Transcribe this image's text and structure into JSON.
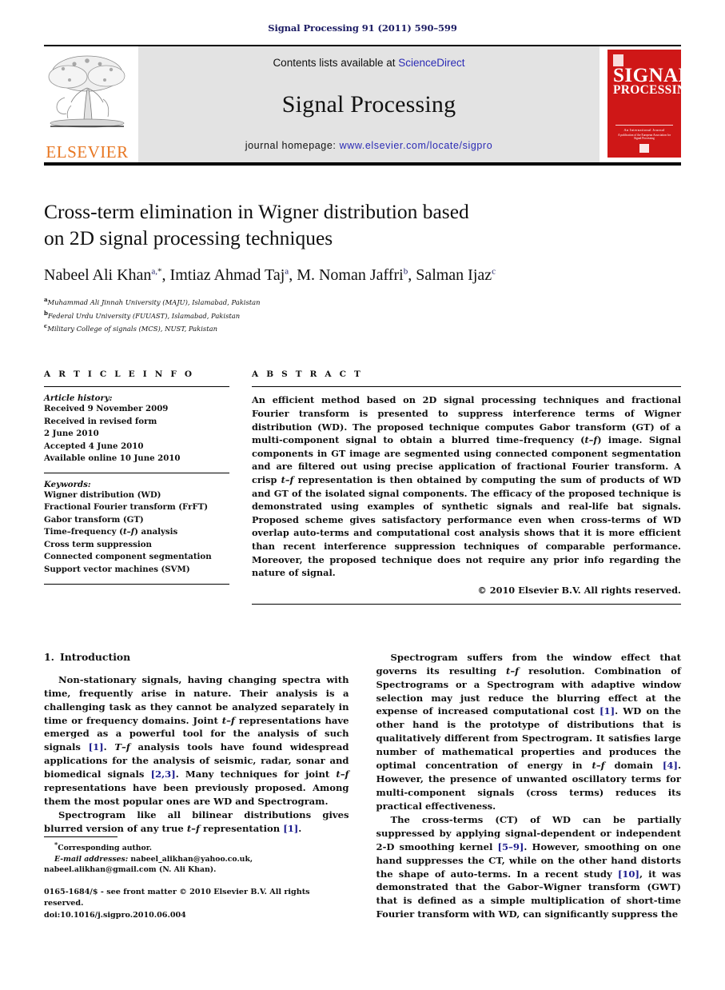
{
  "running_head": "Signal Processing 91 (2011) 590–599",
  "masthead": {
    "elsevier_wordmark": "ELSEVIER",
    "contents_prefix": "Contents lists available at ",
    "contents_link": "ScienceDirect",
    "journal_name": "Signal Processing",
    "homepage_prefix": "journal homepage: ",
    "homepage_link": "www.elsevier.com/locate/sigpro",
    "cover": {
      "title_line1": "SIGNAL",
      "title_line2": "PROCESSING",
      "footer_line1": "An International Journal",
      "footer_line2": "A publication of the European Association for Signal Processing"
    }
  },
  "article": {
    "title_line1": "Cross-term elimination in Wigner distribution based",
    "title_line2": "on 2D signal processing techniques",
    "authors": [
      {
        "name": "Nabeel Ali Khan",
        "sup": "a,",
        "star": "*",
        "sep": ", "
      },
      {
        "name": "Imtiaz Ahmad Taj",
        "sup": "a",
        "star": "",
        "sep": ", "
      },
      {
        "name": "M. Noman Jaffri",
        "sup": "b",
        "star": "",
        "sep": ", "
      },
      {
        "name": "Salman Ijaz",
        "sup": "c",
        "star": "",
        "sep": ""
      }
    ],
    "affiliations": [
      {
        "mark": "a",
        "text": "Muhammad Ali Jinnah University (MAJU), Islamabad, Pakistan"
      },
      {
        "mark": "b",
        "text": "Federal Urdu University (FUUAST), Islamabad, Pakistan"
      },
      {
        "mark": "c",
        "text": "Military College of signals (MCS), NUST, Pakistan"
      }
    ]
  },
  "article_info": {
    "heading": "A R T I C L E   I N F O",
    "history_label": "Article history:",
    "history": [
      "Received 9 November 2009",
      "Received in revised form",
      "2 June 2010",
      "Accepted 4 June 2010",
      "Available online 10 June 2010"
    ],
    "keywords_label": "Keywords:",
    "keywords": [
      "Wigner distribution (WD)",
      "Fractional Fourier transform (FrFT)",
      "Gabor transform (GT)",
      "Time–frequency (t–f) analysis",
      "Cross term suppression",
      "Connected component segmentation",
      "Support vector machines (SVM)"
    ]
  },
  "abstract": {
    "heading": "A B S T R A C T",
    "text": "An efficient method based on 2D signal processing techniques and fractional Fourier transform is presented to suppress interference terms of Wigner distribution (WD). The proposed technique computes Gabor transform (GT) of a multi-component signal to obtain a blurred time–frequency (t–f) image. Signal components in GT image are segmented using connected component segmentation and are filtered out using precise application of fractional Fourier transform. A crisp t–f representation is then obtained by computing the sum of products of WD and GT of the isolated signal components. The efficacy of the proposed technique is demonstrated using examples of synthetic signals and real-life bat signals. Proposed scheme gives satisfactory performance even when cross-terms of WD overlap auto-terms and computational cost analysis shows that it is more efficient than recent interference suppression techniques of comparable performance. Moreover, the proposed technique does not require any prior info regarding the nature of signal.",
    "copyright": "© 2010 Elsevier B.V. All rights reserved."
  },
  "section": {
    "number": "1.",
    "title": "Introduction"
  },
  "body": {
    "left_paragraphs": [
      "Non-stationary signals, having changing spectra with time, frequently arise in nature. Their analysis is a challenging task as they cannot be analyzed separately in time or frequency domains. Joint t–f representations have emerged as a powerful tool for the analysis of such signals [1]. T–f analysis tools have found widespread applications for the analysis of seismic, radar, sonar and biomedical signals [2,3]. Many techniques for joint t–f representations have been previously proposed. Among them the most popular ones are WD and Spectrogram.",
      "Spectrogram like all bilinear distributions gives blurred version of any true t–f representation [1]."
    ],
    "right_paragraphs": [
      "Spectrogram suffers from the window effect that governs its resulting t–f resolution. Combination of Spectrograms or a Spectrogram with adaptive window selection may just reduce the blurring effect at the expense of increased computational cost [1]. WD on the other hand is the prototype of distributions that is qualitatively different from Spectrogram. It satisfies large number of mathematical properties and produces the optimal concentration of energy in t–f domain [4]. However, the presence of unwanted oscillatory terms for multi-component signals (cross terms) reduces its practical effectiveness.",
      "The cross-terms (CT) of WD can be partially suppressed by applying signal-dependent or independent 2-D smoothing kernel [5–9]. However, smoothing on one hand suppresses the CT, while on the other hand distorts the shape of auto-terms. In a recent study [10], it was demonstrated that the Gabor–Wigner transform (GWT) that is defined as a simple multiplication of short-time Fourier transform with WD, can significantly suppress the"
    ]
  },
  "footnotes": {
    "corresponding": "Corresponding author.",
    "email_label": "E-mail addresses:",
    "email_1": "nabeel_alikhan@yahoo.co.uk,",
    "email_2": "nabeel.alikhan@gmail.com (N. Ali Khan).",
    "imprint_line1": "0165-1684/$ - see front matter © 2010 Elsevier B.V. All rights reserved.",
    "imprint_line2": "doi:10.1016/j.sigpro.2010.06.004"
  },
  "colors": {
    "running_head": "#1b1b63",
    "link": "#2b2bb5",
    "citation": "#1b1b8c",
    "elsevier_orange": "#e87722",
    "cover_red": "#cf1717",
    "banner_gray": "#e3e3e3"
  }
}
